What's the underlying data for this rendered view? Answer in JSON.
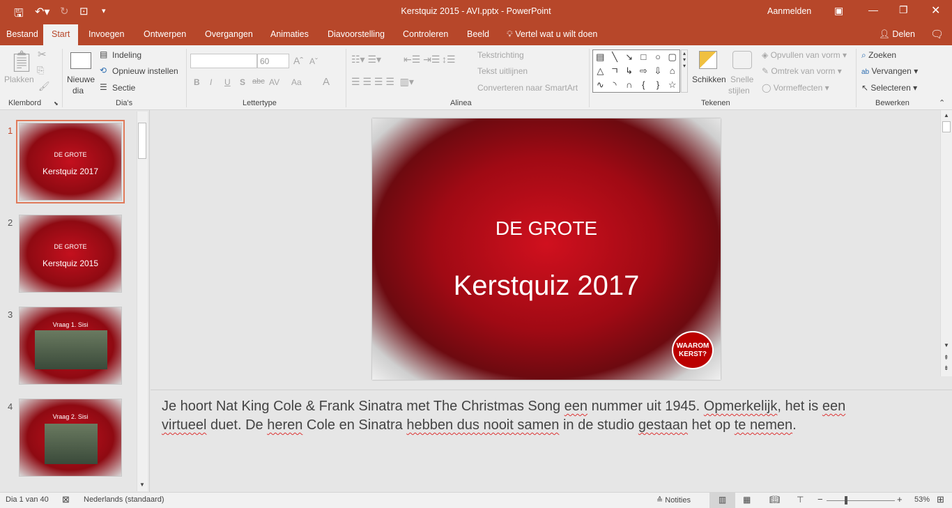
{
  "title": "Kerstquiz 2015 - AVI.pptx  -  PowerPoint",
  "signin": "Aanmelden",
  "qat": {
    "save": "save-icon",
    "undo": "undo-icon",
    "redo": "redo-icon",
    "present": "present-icon",
    "more": "▾"
  },
  "tabs": [
    "Bestand",
    "Start",
    "Invoegen",
    "Ontwerpen",
    "Overgangen",
    "Animaties",
    "Diavoorstelling",
    "Controleren",
    "Beeld"
  ],
  "tell_me": "Vertel wat u wilt doen",
  "share": "Delen",
  "ribbon": {
    "clipboard": {
      "paste": "Plakken",
      "label": "Klembord"
    },
    "slides": {
      "new": "Nieuwe",
      "new2": "dia",
      "layout": "Indeling",
      "reset": "Opnieuw instellen",
      "section": "Sectie",
      "label": "Dia's"
    },
    "font": {
      "name": "",
      "size": "60",
      "bold": "B",
      "italic": "I",
      "underline": "U",
      "shadow": "S",
      "strike": "abc",
      "spacing": "AV",
      "case": "Aa",
      "color": "A",
      "label": "Lettertype"
    },
    "paragraph": {
      "direction": "Tekstrichting",
      "align": "Tekst uitlijnen",
      "smartart": "Converteren naar SmartArt",
      "label": "Alinea"
    },
    "drawing": {
      "arrange": "Schikken",
      "quick": "Snelle",
      "quick2": "stijlen",
      "fill": "Opvullen van vorm",
      "outline": "Omtrek van vorm",
      "effects": "Vormeffecten",
      "label": "Tekenen",
      "shapes": [
        "▤",
        "╲",
        "↘",
        "□",
        "○",
        "▢",
        "△",
        "ㄱ",
        "↳",
        "⇨",
        "⇩",
        "⌂",
        "∿",
        "◝",
        "∩",
        "{",
        "}",
        "☆"
      ]
    },
    "editing": {
      "find": "Zoeken",
      "replace": "Vervangen",
      "select": "Selecteren",
      "label": "Bewerken"
    }
  },
  "slides": [
    {
      "num": "1",
      "line1": "DE GROTE",
      "line2": "Kerstquiz 2017"
    },
    {
      "num": "2",
      "line1": "DE GROTE",
      "line2": "Kerstquiz 2015"
    },
    {
      "num": "3",
      "line1": "Vraag 1. Sisi",
      "line2": ""
    },
    {
      "num": "4",
      "line1": "Vraag 2. Sisi",
      "line2": ""
    }
  ],
  "current_slide": {
    "heading": "DE GROTE",
    "title": "Kerstquiz 2017",
    "logo": "WAAROM KERST?"
  },
  "notes": {
    "p1": "Je hoort Nat King Cole & Frank Sinatra met The Christmas Song ",
    "p2": "een",
    "p3": " nummer uit 1945. ",
    "p4": "Opmerkelijk",
    "p5": ", het is ",
    "p6": "een",
    "p7": "virtueel",
    "p8": " duet. De ",
    "p9": "heren",
    "p10": " Cole en Sinatra ",
    "p11": "hebben dus nooit samen",
    "p12": " in de studio ",
    "p13": "gestaan",
    "p14": " het op ",
    "p15": "te nemen",
    "p16": "."
  },
  "status": {
    "slide": "Dia 1 van 40",
    "language": "Nederlands (standaard)",
    "notes": "Notities",
    "zoom": "53%",
    "zoom_fraction": 0.53
  }
}
